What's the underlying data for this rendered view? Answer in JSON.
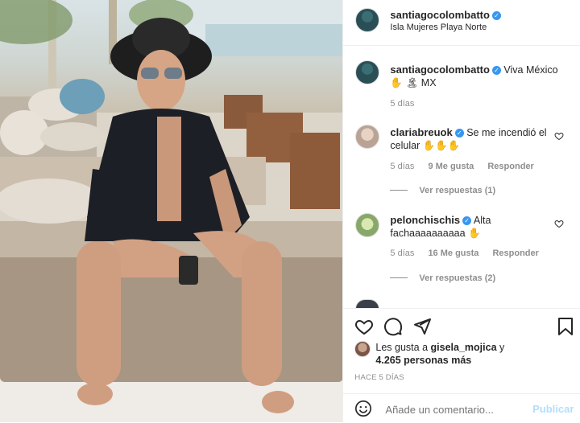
{
  "post": {
    "username": "santiagocolombatto",
    "location": "Isla Mujeres Playa Norte"
  },
  "caption": {
    "username": "santiagocolombatto",
    "text": "Viva México",
    "emoji_line": "✋ 🏝 MX",
    "time": "5 días"
  },
  "comments": [
    {
      "username": "clariabreuok",
      "text": "Se me incendió el celular ✋✋✋",
      "time": "5 días",
      "likes": "9 Me gusta",
      "reply": "Responder",
      "view_replies": "Ver respuestas (1)"
    },
    {
      "username": "pelonchischis",
      "text": "Alta fachaaaaaaaaaa ✋",
      "time": "5 días",
      "likes": "16 Me gusta",
      "reply": "Responder",
      "view_replies": "Ver respuestas (2)"
    }
  ],
  "likes": {
    "prefix": "Les gusta a",
    "user": "gisela_mojica",
    "conj": "y",
    "others": "4.265 personas más"
  },
  "posted": "HACE 5 DÍAS",
  "add_comment": {
    "placeholder": "Añade un comentario...",
    "publish": "Publicar"
  },
  "colors": {
    "verified": "#3897f0",
    "publish": "#b2dffc"
  }
}
